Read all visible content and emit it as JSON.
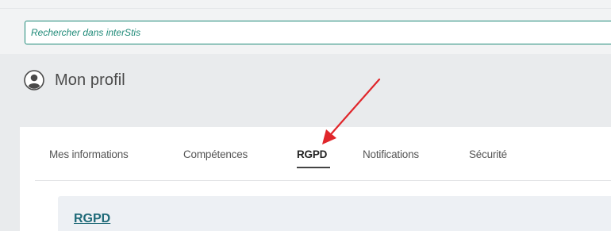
{
  "search": {
    "placeholder": "Rechercher dans interStis"
  },
  "profile": {
    "title": "Mon profil",
    "icon": "user-avatar-icon"
  },
  "tabs": [
    {
      "label": "Mes informations",
      "active": false
    },
    {
      "label": "Compétences",
      "active": false
    },
    {
      "label": "RGPD",
      "active": true
    },
    {
      "label": "Notifications",
      "active": false
    },
    {
      "label": "Sécurité",
      "active": false
    }
  ],
  "section": {
    "title": "RGPD"
  },
  "annotation": {
    "icon": "red-arrow-icon",
    "color": "#e0262b"
  },
  "colors": {
    "accent": "#1f8a78",
    "link": "#1f6a78",
    "page_background": "#e9ebed"
  }
}
